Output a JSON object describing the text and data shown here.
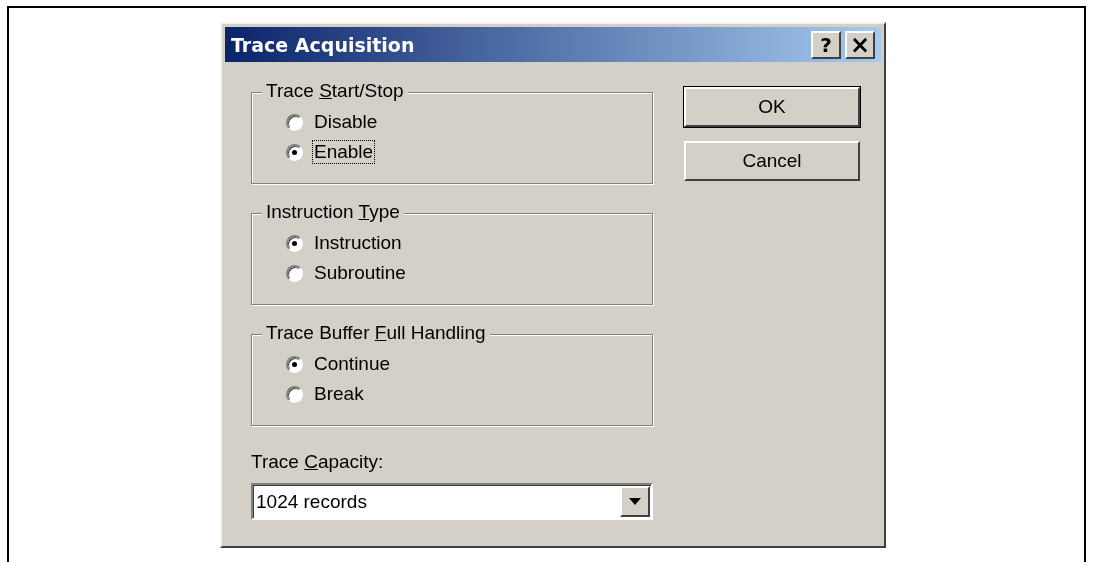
{
  "window": {
    "title": "Trace Acquisition",
    "title_buttons": [
      {
        "kind": "help",
        "label": "?"
      },
      {
        "kind": "close",
        "label": "×"
      }
    ]
  },
  "groups": [
    {
      "title": {
        "before": "Trace ",
        "key": "S",
        "after": "tart/Stop"
      },
      "options": [
        {
          "label": "Disable",
          "selected": false,
          "focused": false
        },
        {
          "label": "Enable",
          "selected": true,
          "focused": true
        }
      ]
    },
    {
      "title": {
        "before": "Instruction ",
        "key": "T",
        "after": "ype"
      },
      "options": [
        {
          "label": "Instruction",
          "selected": true,
          "focused": false
        },
        {
          "label": "Subroutine",
          "selected": false,
          "focused": false
        }
      ]
    },
    {
      "title": {
        "before": "Trace Buffer ",
        "key": "F",
        "after": "ull Handling"
      },
      "options": [
        {
          "label": "Continue",
          "selected": true,
          "focused": false
        },
        {
          "label": "Break",
          "selected": false,
          "focused": false
        }
      ]
    }
  ],
  "capacity": {
    "label": {
      "before": "Trace ",
      "key": "C",
      "after": "apacity:"
    },
    "value": "1024 records"
  },
  "buttons": [
    {
      "label": "OK",
      "default": true
    },
    {
      "label": "Cancel",
      "default": false
    }
  ]
}
